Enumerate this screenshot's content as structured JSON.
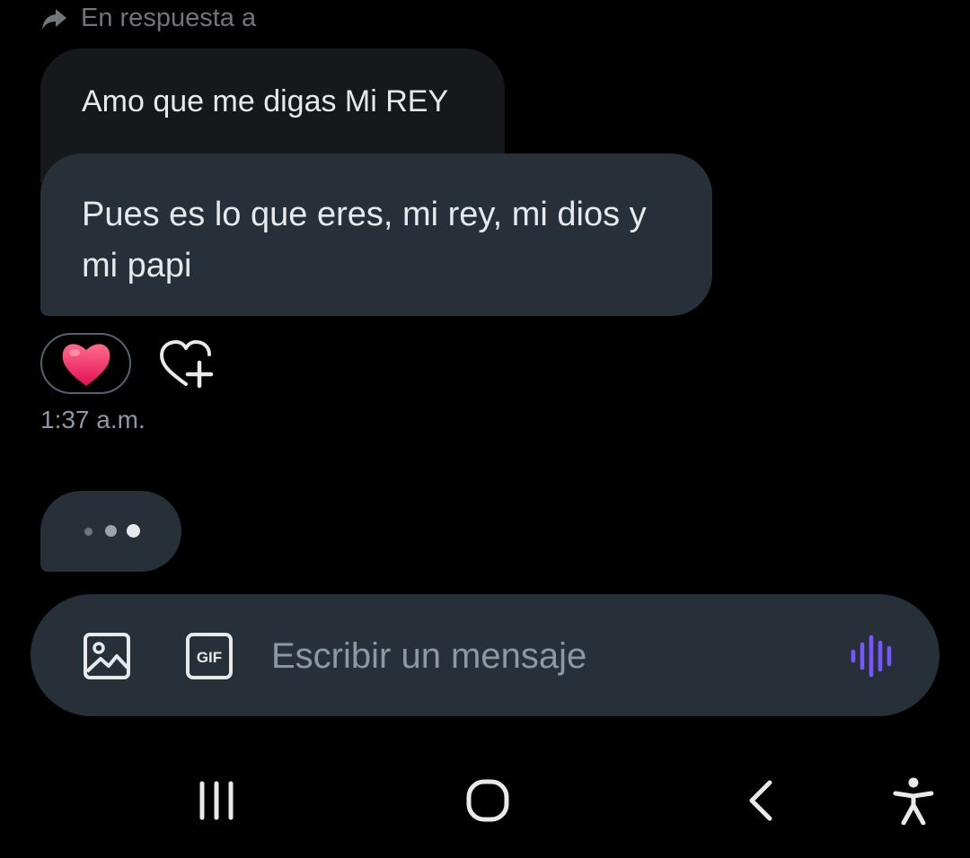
{
  "reply_header": {
    "label": "En respuesta a"
  },
  "quoted_message": {
    "text": "Amo que me digas Mi REY"
  },
  "message": {
    "text": "Pues es lo que eres, mi rey, mi dios y mi papi"
  },
  "reaction": {
    "emoji": "heart",
    "add_icon": "heart-plus-icon"
  },
  "timestamp": "1:37 a.m.",
  "typing_indicator": {
    "icon": "typing-dots"
  },
  "composer": {
    "placeholder": "Escribir un mensaje",
    "image_icon": "image-icon",
    "gif_icon": "gif-icon",
    "gif_label": "GIF",
    "voice_icon": "voice-wave-icon"
  },
  "navbar": {
    "recents_icon": "recents-icon",
    "home_icon": "home-icon",
    "back_icon": "back-icon",
    "accessibility_icon": "accessibility-icon"
  },
  "colors": {
    "background": "#000000",
    "bubble": "#273038",
    "quoted_bubble": "#16181c",
    "accent_voice": "#7856ff",
    "heart": "#f91880",
    "muted_text": "#71767b"
  }
}
